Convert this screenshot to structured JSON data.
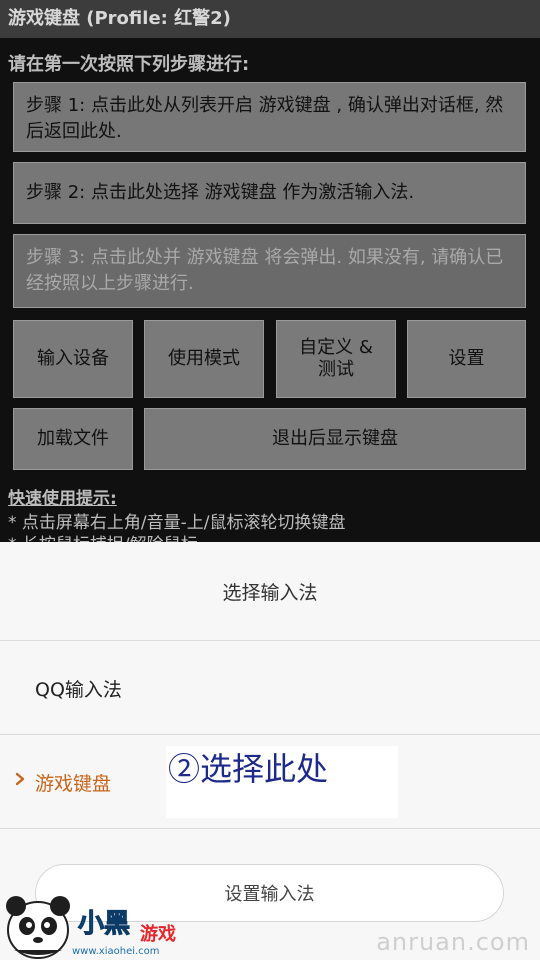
{
  "titlebar": {
    "title": "游戏键盘 (Profile: 红警2)"
  },
  "main": {
    "intro": "请在第一次按照下列步骤进行:",
    "step1": "步骤 1: 点击此处从列表开启 游戏键盘 , 确认弹出对话框, 然后返回此处.",
    "step2": "步骤 2: 点击此处选择 游戏键盘 作为激活输入法.",
    "step3": "步骤 3: 点击此处并 游戏键盘 将会弹出. 如果没有, 请确认已经按照以上步骤进行.",
    "buttons": {
      "input_device": "输入设备",
      "usage_mode": "使用模式",
      "customize_line1": "自定义 &",
      "customize_line2": "测试",
      "settings": "设置",
      "load_file": "加载文件",
      "show_keyboard_on_exit": "退出后显示键盘"
    },
    "tips_title": "快速使用提示:",
    "tip1": "* 点击屏幕右上角/音量-上/鼠标滚轮切换键盘",
    "tip2": "* 长按鼠标捕捉/解除鼠标"
  },
  "sheet": {
    "title": "选择输入法",
    "options": [
      {
        "label": "QQ输入法"
      },
      {
        "label": "游戏键盘"
      }
    ],
    "setup_button": "设置输入法",
    "accent_color": "#c8651a"
  },
  "annotation": {
    "text": "②选择此处"
  },
  "watermarks": {
    "right": "anruan.com",
    "logo_title": "小黑游戏",
    "logo_url": "www.xiaohei.com"
  }
}
